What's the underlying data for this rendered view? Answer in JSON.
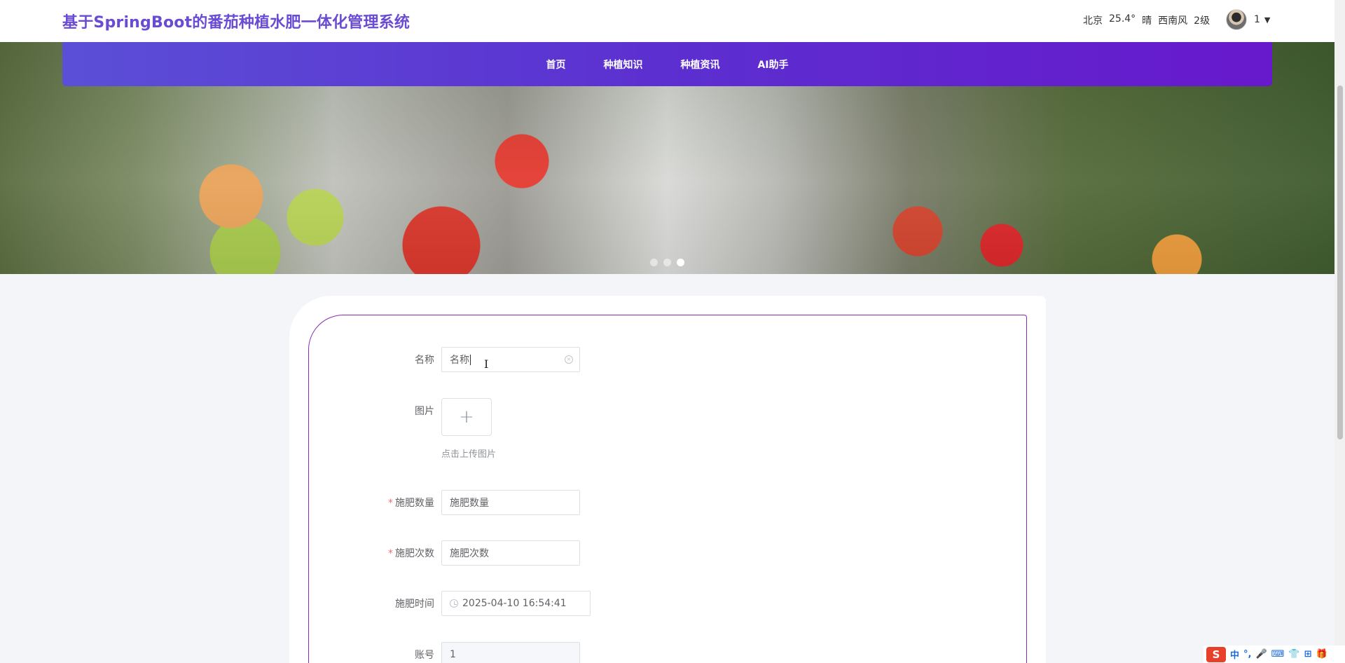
{
  "header": {
    "title": "基于SpringBoot的番茄种植水肥一体化管理系统",
    "weather": {
      "city": "北京",
      "temperature": "25.4°",
      "condition": "晴",
      "wind_direction": "西南风",
      "wind_level": "2级"
    },
    "user": {
      "name": "1",
      "caret": "▼"
    }
  },
  "nav": {
    "items": [
      {
        "label": "首页"
      },
      {
        "label": "种植知识"
      },
      {
        "label": "种植资讯"
      },
      {
        "label": "AI助手"
      }
    ]
  },
  "carousel": {
    "slide_count": 3,
    "active_index": 2
  },
  "form": {
    "name": {
      "label": "名称",
      "value": "名称",
      "placeholder": "名称"
    },
    "image": {
      "label": "图片",
      "upload_icon": "+",
      "upload_tip": "点击上传图片"
    },
    "fertilizer_amount": {
      "required_mark": "*",
      "label": "施肥数量",
      "placeholder": "施肥数量"
    },
    "fertilizer_count": {
      "required_mark": "*",
      "label": "施肥次数",
      "placeholder": "施肥次数"
    },
    "fertilizer_time": {
      "label": "施肥时间",
      "value": "2025-04-10 16:54:41"
    },
    "account": {
      "label": "账号",
      "value": "1"
    }
  },
  "ime_toolbar": {
    "logo": "S",
    "items": [
      "中",
      "°,",
      "🎤",
      "⌨",
      "👕",
      "⊞",
      "🎁"
    ]
  },
  "colors": {
    "title": "#6a4bd3",
    "nav_start": "#5b4fd7",
    "nav_end": "#6719cc",
    "card_border": "#8a2cb0",
    "required": "#f56c6c"
  }
}
